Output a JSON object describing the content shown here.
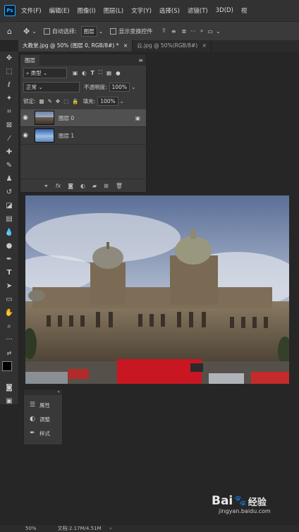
{
  "menu": [
    "文件(F)",
    "编辑(E)",
    "图像(I)",
    "图层(L)",
    "文字(Y)",
    "选择(S)",
    "滤镜(T)",
    "3D(D)",
    "视"
  ],
  "options": {
    "auto_select_label": "自动选择:",
    "auto_select_value": "图层",
    "show_transform_label": "显示变换控件"
  },
  "tabs": [
    {
      "label": "大教堂.jpg @ 50% (图层 0, RGB/8#) *",
      "active": true
    },
    {
      "label": "云.jpg @ 50%(RGB/8#)",
      "active": false
    }
  ],
  "layers_panel": {
    "title": "图层",
    "filter_label": "类型",
    "blend_mode": "正常",
    "opacity_label": "不透明度:",
    "opacity_value": "100%",
    "lock_label": "锁定:",
    "fill_label": "填充:",
    "fill_value": "100%",
    "layers": [
      {
        "name": "图层 0",
        "selected": true
      },
      {
        "name": "图层 1",
        "selected": false
      }
    ]
  },
  "properties_panel": {
    "items": [
      "属性",
      "调整",
      "样式"
    ]
  },
  "status": {
    "zoom": "50%",
    "doc": "文档:2.17M/4.51M"
  },
  "watermark": {
    "brand": "Bai",
    "brand2": "经验",
    "url": "jingyan.baidu.com"
  },
  "colors": {
    "accent": "#31a8ff",
    "bar": "#323232",
    "panel": "#393939",
    "canvas_bg": "#262626"
  }
}
